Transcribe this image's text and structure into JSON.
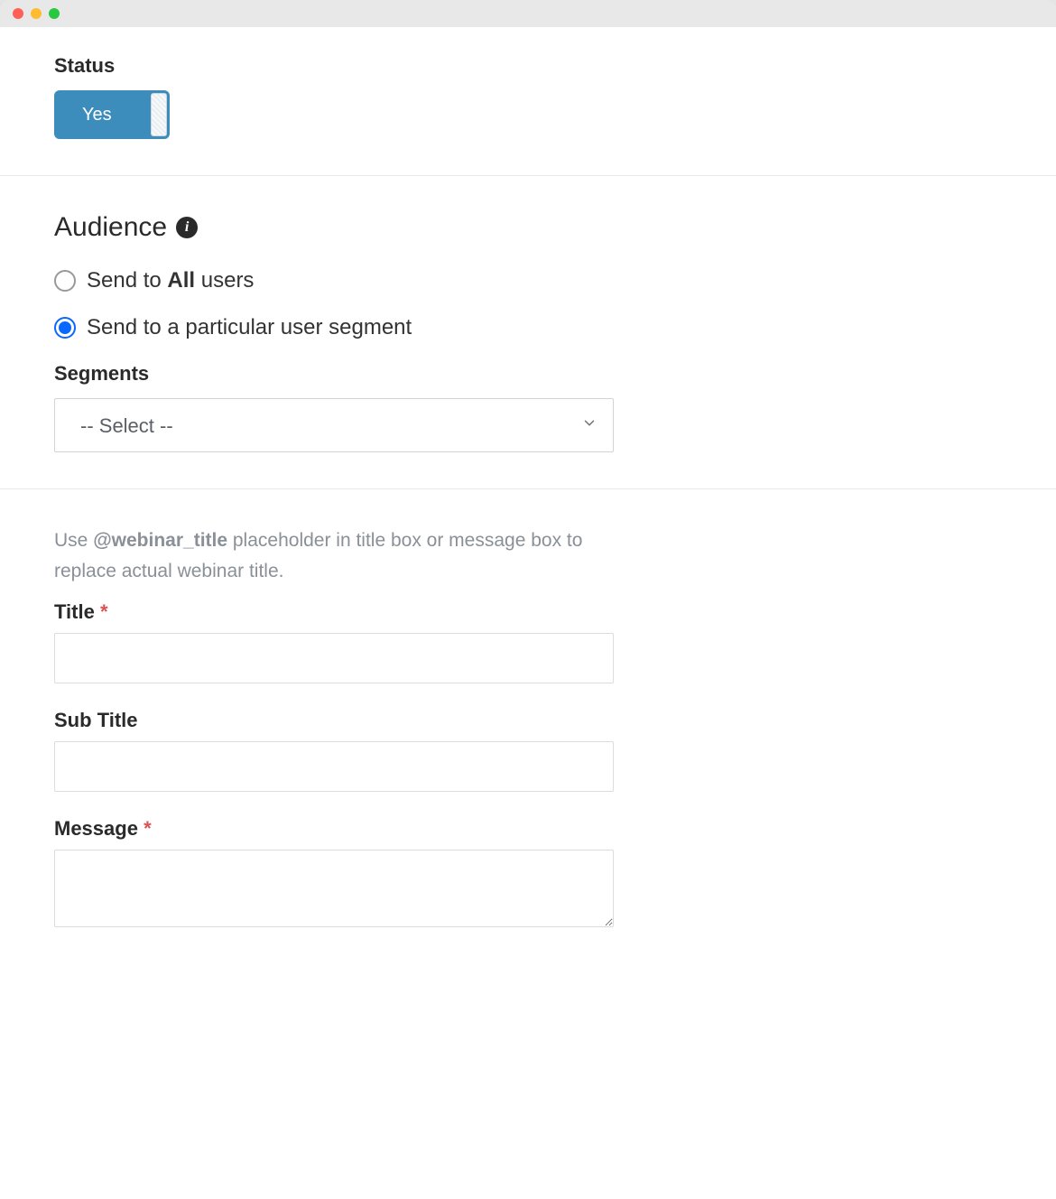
{
  "status": {
    "label": "Status",
    "toggle_value": "Yes"
  },
  "audience": {
    "title": "Audience",
    "options": {
      "all_prefix": "Send to ",
      "all_bold": "All",
      "all_suffix": " users",
      "segment": "Send to a particular user segment"
    },
    "selected": "segment",
    "segments_label": "Segments",
    "segments_placeholder": "-- Select --"
  },
  "message_section": {
    "helper_prefix": "Use ",
    "helper_bold": "@webinar_title",
    "helper_suffix": " placeholder in title box or message box to replace actual webinar title.",
    "title_label": "Title",
    "title_value": "",
    "subtitle_label": "Sub Title",
    "subtitle_value": "",
    "message_label": "Message",
    "message_value": "",
    "required_marker": "*"
  }
}
